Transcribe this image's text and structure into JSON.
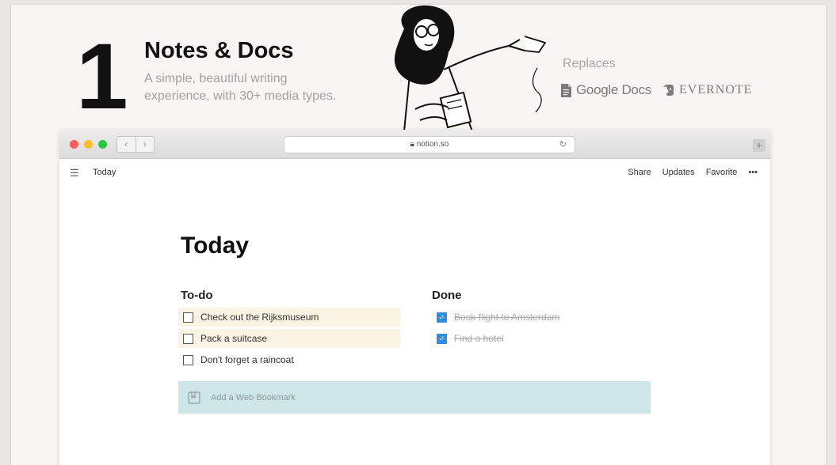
{
  "feature": {
    "number": "1",
    "title": "Notes & Docs",
    "subtitle_line1": "A simple, beautiful writing",
    "subtitle_line2": "experience, with 30+ media types."
  },
  "replaces": {
    "label": "Replaces",
    "products": [
      {
        "name": "Google Docs",
        "icon": "google-docs-icon"
      },
      {
        "name": "EVERNOTE",
        "icon": "evernote-icon"
      }
    ]
  },
  "browser": {
    "url": "notion.so",
    "nav_back": "‹",
    "nav_forward": "›"
  },
  "app": {
    "breadcrumb": "Today",
    "actions": [
      "Share",
      "Updates",
      "Favorite",
      "•••"
    ]
  },
  "page": {
    "title": "Today",
    "todo_heading": "To-do",
    "done_heading": "Done",
    "todo_items": [
      "Check out the Rijksmuseum",
      "Pack a suitcase",
      "Don't forget a raincoat"
    ],
    "done_items": [
      "Book flight to Amsterdam",
      "Find a hotel"
    ],
    "bookmark_placeholder": "Add a Web Bookmark"
  },
  "colors": {
    "highlight": "#fbf3e4",
    "checked": "#2e8de0",
    "bookmark_bg": "#cfe6e9"
  }
}
